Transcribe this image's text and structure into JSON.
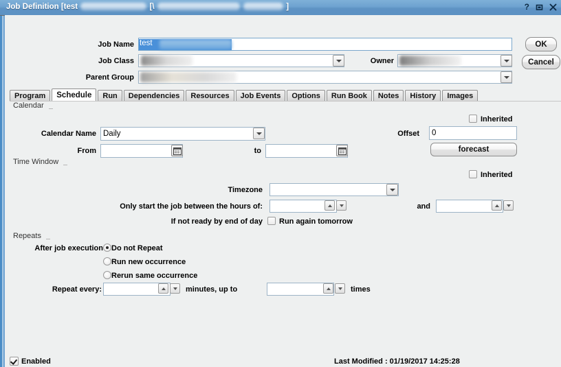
{
  "window": {
    "title_prefix": "Job Definition [test",
    "title_mid": "[\\",
    "title_suffix": "]",
    "controls": {
      "help": "?",
      "maximize": "maximize-icon",
      "close": "close-icon"
    }
  },
  "header": {
    "job_name": {
      "label": "Job Name",
      "value": "test",
      "selected": true
    },
    "job_class": {
      "label": "Job Class",
      "value": "",
      "redacted": true
    },
    "parent_group": {
      "label": "Parent Group",
      "value": "",
      "redacted": true
    },
    "owner": {
      "label": "Owner",
      "value": "",
      "redacted": true
    }
  },
  "dialog_buttons": {
    "ok": "OK",
    "cancel": "Cancel"
  },
  "tabs": [
    {
      "label": "Program",
      "active": false
    },
    {
      "label": "Schedule",
      "active": true
    },
    {
      "label": "Run",
      "active": false
    },
    {
      "label": "Dependencies",
      "active": false
    },
    {
      "label": "Resources",
      "active": false
    },
    {
      "label": "Job Events",
      "active": false
    },
    {
      "label": "Options",
      "active": false
    },
    {
      "label": "Run Book",
      "active": false
    },
    {
      "label": "Notes",
      "active": false
    },
    {
      "label": "History",
      "active": false
    },
    {
      "label": "Images",
      "active": false
    }
  ],
  "calendar_section": {
    "group_label": "Calendar",
    "inherited": {
      "label": "Inherited",
      "checked": false
    },
    "calendar_name": {
      "label": "Calendar Name",
      "value": "Daily"
    },
    "from": {
      "label": "From",
      "value": ""
    },
    "to": {
      "label": "to",
      "value": ""
    },
    "offset": {
      "label": "Offset",
      "value": "0"
    },
    "forecast_button": "forecast"
  },
  "time_window_section": {
    "group_label": "Time Window",
    "inherited": {
      "label": "Inherited",
      "checked": false
    },
    "timezone": {
      "label": "Timezone",
      "value": ""
    },
    "hours": {
      "label": "Only start the job between the hours of:",
      "from_value": "",
      "and_label": "and",
      "to_value": ""
    },
    "end_of_day": {
      "label": "If not ready by end of day",
      "checkbox_label": "Run again tomorrow",
      "checked": false
    }
  },
  "repeats_section": {
    "group_label": "Repeats",
    "after_job_execution_label": "After job execution",
    "options": [
      {
        "label": "Do not Repeat",
        "selected": true
      },
      {
        "label": "Run new occurrence",
        "selected": false
      },
      {
        "label": "Rerun same occurrence",
        "selected": false
      }
    ],
    "repeat_every": {
      "label": "Repeat every:",
      "value": "",
      "unit_label": "minutes, up to",
      "count_value": "",
      "times_label": "times"
    }
  },
  "footer": {
    "enabled": {
      "label": "Enabled",
      "checked": true
    },
    "last_modified": "Last Modified : 01/19/2017 14:25:28"
  }
}
